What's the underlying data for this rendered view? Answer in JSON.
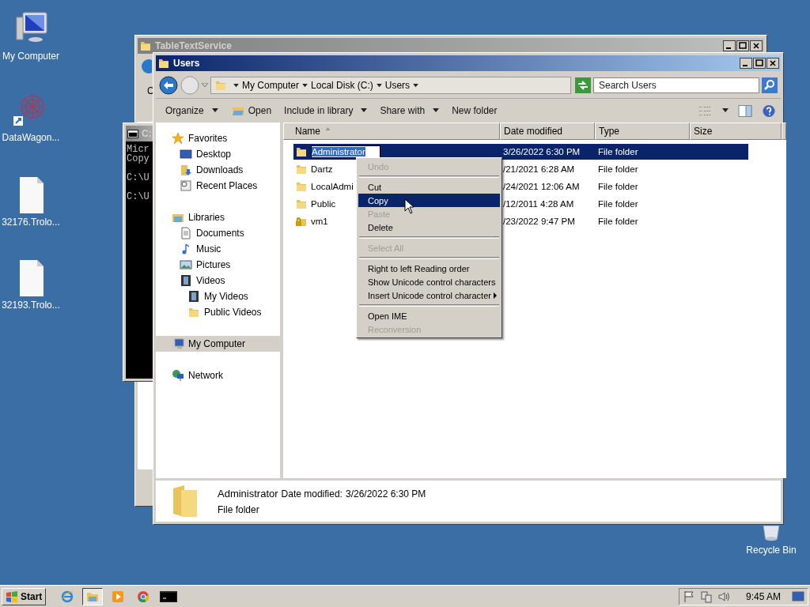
{
  "desktop_icons": [
    {
      "kind": "computer",
      "label": "My Computer"
    },
    {
      "kind": "app",
      "label": "DataWagon..."
    },
    {
      "kind": "file",
      "label": "32176.Trolo..."
    },
    {
      "kind": "file",
      "label": "32193.Trolo..."
    },
    {
      "kind": "recycle",
      "label": "Recycle Bin"
    }
  ],
  "back_window": {
    "title": "TableTextService",
    "fragment": "C"
  },
  "console": {
    "title": "C:",
    "blocks": [
      [
        "Micr",
        "Copy"
      ],
      [
        "C:\\U"
      ],
      [
        "C:\\U"
      ]
    ]
  },
  "explorer": {
    "title": "Users",
    "breadcrumbs": [
      "My Computer",
      "Local Disk (C:)",
      "Users"
    ],
    "search": {
      "placeholder": "Search Users"
    },
    "toolbar": [
      {
        "label": "Organize",
        "kind": "menu"
      },
      {
        "label": "Open",
        "kind": "icon"
      },
      {
        "label": "Include in library",
        "kind": "menu"
      },
      {
        "label": "Share with",
        "kind": "menu"
      },
      {
        "label": "New folder",
        "kind": "plain"
      }
    ],
    "nav": [
      {
        "label": "Favorites",
        "kind": "star",
        "selected": false,
        "children": [
          {
            "label": "Desktop",
            "kind": "desktop",
            "selected": false
          },
          {
            "label": "Downloads",
            "kind": "downloads",
            "selected": false
          },
          {
            "label": "Recent Places",
            "kind": "recent",
            "selected": false
          }
        ]
      },
      {
        "label": "Libraries",
        "kind": "library",
        "selected": false,
        "children": [
          {
            "label": "Documents",
            "kind": "document",
            "selected": false
          },
          {
            "label": "Music",
            "kind": "music",
            "selected": false
          },
          {
            "label": "Pictures",
            "kind": "pictures",
            "selected": false
          },
          {
            "label": "Videos",
            "kind": "videos",
            "selected": false,
            "children": [
              {
                "label": "My Videos",
                "kind": "videofolder",
                "selected": false
              },
              {
                "label": "Public Videos",
                "kind": "folder",
                "selected": false
              }
            ]
          }
        ]
      },
      {
        "label": "My Computer",
        "kind": "computer",
        "selected": true
      },
      {
        "label": "Network",
        "kind": "network",
        "selected": false
      }
    ],
    "columns": [
      {
        "label": "Name",
        "sorted": true
      },
      {
        "label": "Date modified",
        "sorted": false
      },
      {
        "label": "Type",
        "sorted": false
      },
      {
        "label": "Size",
        "sorted": false
      }
    ],
    "rows": [
      {
        "kind": "folder",
        "name": "Administrator",
        "date": "3/26/2022 6:30 PM",
        "type": "File folder",
        "selected": true,
        "renaming": true
      },
      {
        "kind": "folder",
        "name": "Dartz",
        "date": "/21/2021 6:28 AM",
        "type": "File folder",
        "selected": false,
        "renaming": false
      },
      {
        "kind": "folder",
        "name": "LocalAdmi",
        "date": "/24/2021 12:06 AM",
        "type": "File folder",
        "selected": false,
        "renaming": false
      },
      {
        "kind": "folder",
        "name": "Public",
        "date": "/12/2011 4:28 AM",
        "type": "File folder",
        "selected": false,
        "renaming": false
      },
      {
        "kind": "locked",
        "name": "vm1",
        "date": "/23/2022 9:47 PM",
        "type": "File folder",
        "selected": false,
        "renaming": false
      }
    ],
    "details": {
      "name": "Administrator",
      "date_label": "Date modified:",
      "date": "3/26/2022 6:30 PM",
      "type": "File folder"
    }
  },
  "context_menu": [
    {
      "kind": "item",
      "label": "Undo",
      "disabled": true,
      "selected": false,
      "submenu": false
    },
    {
      "kind": "separator"
    },
    {
      "kind": "item",
      "label": "Cut",
      "disabled": false,
      "selected": false,
      "submenu": false
    },
    {
      "kind": "item",
      "label": "Copy",
      "disabled": false,
      "selected": true,
      "submenu": false
    },
    {
      "kind": "item",
      "label": "Paste",
      "disabled": true,
      "selected": false,
      "submenu": false
    },
    {
      "kind": "item",
      "label": "Delete",
      "disabled": false,
      "selected": false,
      "submenu": false
    },
    {
      "kind": "separator"
    },
    {
      "kind": "item",
      "label": "Select All",
      "disabled": true,
      "selected": false,
      "submenu": false
    },
    {
      "kind": "separator"
    },
    {
      "kind": "item",
      "label": "Right to left Reading order",
      "disabled": false,
      "selected": false,
      "submenu": false
    },
    {
      "kind": "item",
      "label": "Show Unicode control characters",
      "disabled": false,
      "selected": false,
      "submenu": false
    },
    {
      "kind": "item",
      "label": "Insert Unicode control character",
      "disabled": false,
      "selected": false,
      "submenu": true
    },
    {
      "kind": "separator"
    },
    {
      "kind": "item",
      "label": "Open IME",
      "disabled": false,
      "selected": false,
      "submenu": false
    },
    {
      "kind": "item",
      "label": "Reconversion",
      "disabled": true,
      "selected": false,
      "submenu": false
    }
  ],
  "taskbar": {
    "start": "Start",
    "apps": [
      {
        "kind": "browser",
        "active": false
      },
      {
        "kind": "explorer",
        "active": true
      },
      {
        "kind": "media",
        "active": false
      },
      {
        "kind": "chrome",
        "active": false
      },
      {
        "kind": "console",
        "active": false
      }
    ],
    "clock": "9:45 AM"
  }
}
